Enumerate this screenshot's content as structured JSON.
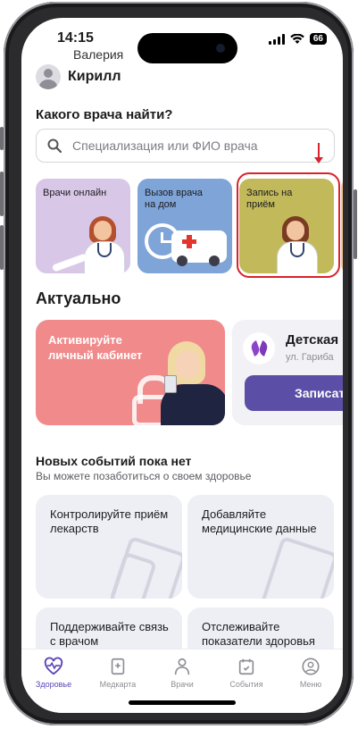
{
  "status": {
    "time": "14:15",
    "battery": "66"
  },
  "profile": {
    "previous_name": "Валерия",
    "name": "Кирилл"
  },
  "find": {
    "title": "Какого врача найти?",
    "search_placeholder": "Специализация или ФИО врача"
  },
  "service_cards": [
    {
      "label": "Врачи онлайн",
      "color": "#d9c7e8"
    },
    {
      "label": "Вызов врача на дом",
      "color": "#7fa4d8"
    },
    {
      "label": "Запись на приём",
      "color": "#c2b95a"
    }
  ],
  "actual": {
    "title": "Актуально",
    "promo_text": "Активируйте личный кабинет",
    "clinic_name": "Детская",
    "clinic_address": "ул. Гариба",
    "clinic_button": "Записат"
  },
  "events": {
    "title": "Новых событий пока нет",
    "subtitle": "Вы можете позаботиться о своем здоровье",
    "tiles": [
      "Контролируйте приём лекарств",
      "Добавляйте медицинские данные",
      "Поддерживайте связь с врачом",
      "Отслеживайте показатели здоровья"
    ]
  },
  "tabs": [
    {
      "label": "Здоровье",
      "icon": "heart-pulse-icon",
      "active": true
    },
    {
      "label": "Медкарта",
      "icon": "medical-card-icon"
    },
    {
      "label": "Врачи",
      "icon": "doctor-icon"
    },
    {
      "label": "События",
      "icon": "calendar-icon"
    },
    {
      "label": "Меню",
      "icon": "menu-profile-icon"
    }
  ],
  "colors": {
    "accent": "#5a45b8",
    "highlight": "#d8232a",
    "promo": "#f08a8b",
    "button": "#5b4ea6"
  }
}
